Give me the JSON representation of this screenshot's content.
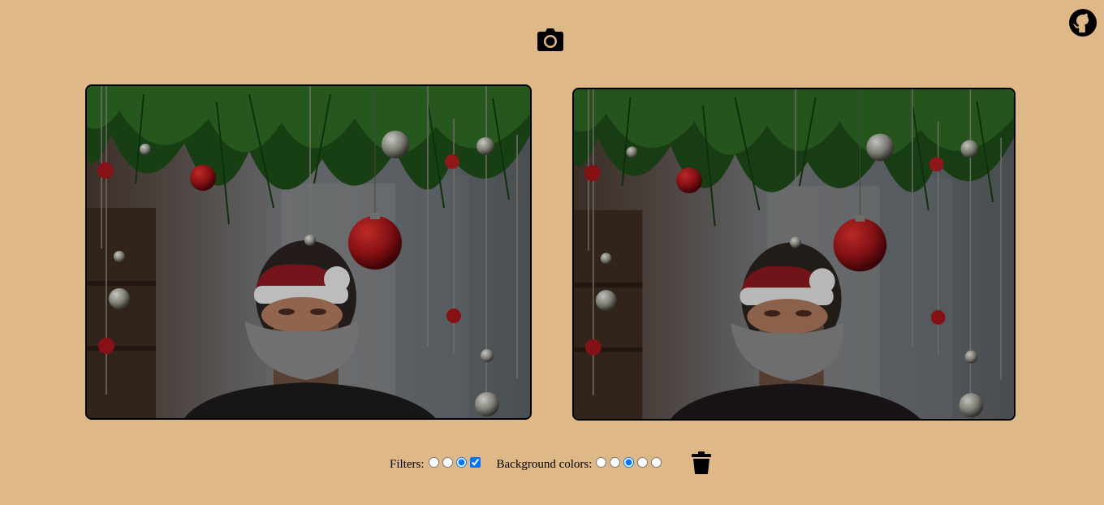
{
  "toolbar": {
    "camera_icon": "camera-icon",
    "github_icon": "github-icon"
  },
  "controls": {
    "filters_label": "Filters:",
    "filters_options": [
      {
        "type": "radio",
        "checked": false
      },
      {
        "type": "radio",
        "checked": false
      },
      {
        "type": "radio",
        "checked": true
      },
      {
        "type": "checkbox",
        "checked": true
      }
    ],
    "background_label": "Background colors:",
    "background_options": [
      {
        "type": "radio",
        "checked": false
      },
      {
        "type": "radio",
        "checked": false
      },
      {
        "type": "radio",
        "checked": true
      },
      {
        "type": "radio",
        "checked": false
      },
      {
        "type": "radio",
        "checked": false
      }
    ],
    "delete_icon": "trash-icon"
  },
  "colors": {
    "page_background": "#deb887",
    "frame_border": "#000000",
    "accent": "#0a76f6"
  }
}
